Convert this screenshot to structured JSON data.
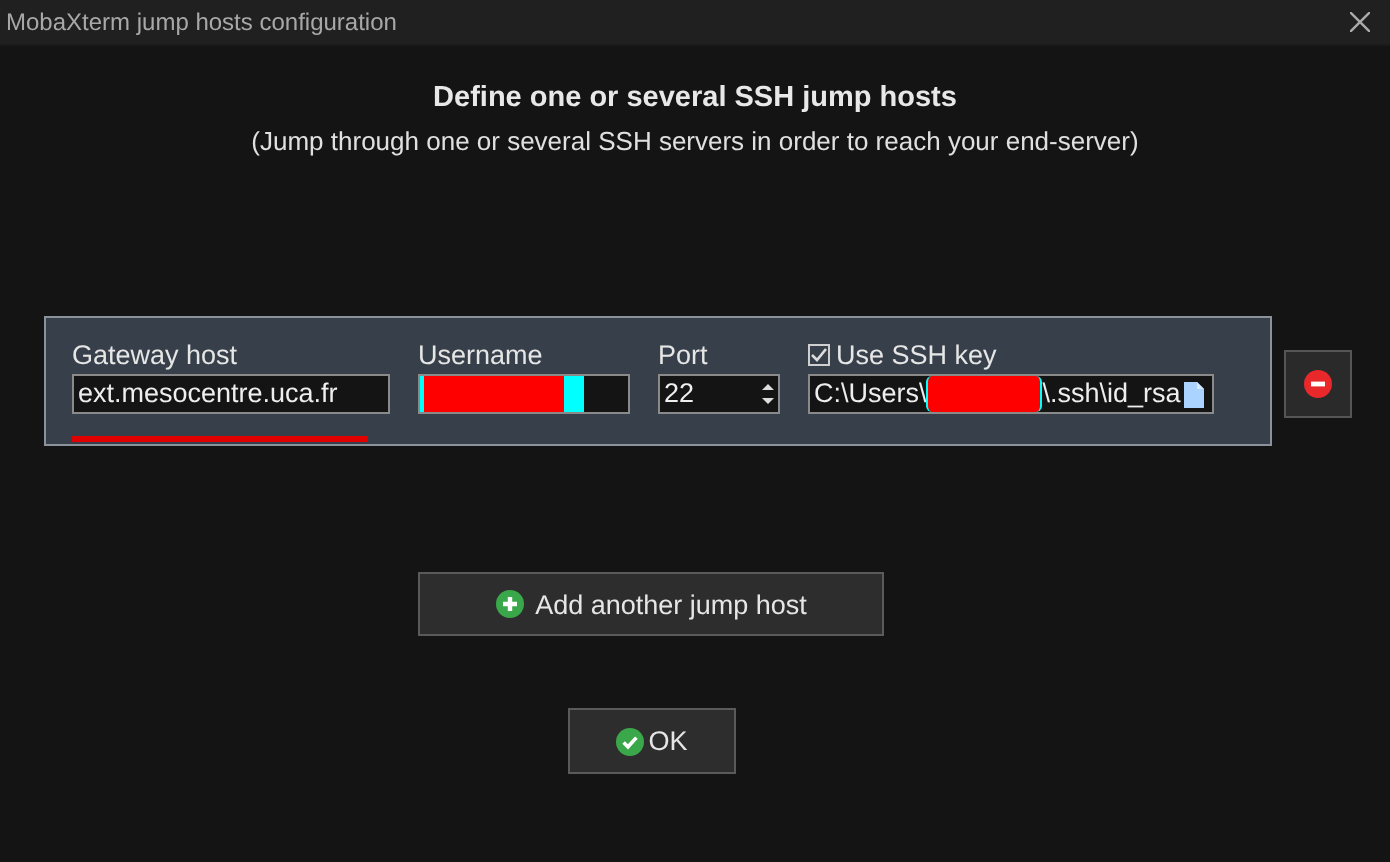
{
  "window": {
    "title": "MobaXterm jump hosts configuration"
  },
  "heading": "Define one or several SSH jump hosts",
  "subheading": "(Jump through one or several SSH servers in order to reach your end-server)",
  "hosts": [
    {
      "gateway_host": {
        "label": "Gateway host",
        "value": "ext.mesocentre.uca.fr",
        "underlined": true
      },
      "username": {
        "label": "Username",
        "redacted": true
      },
      "port": {
        "label": "Port",
        "value": "22"
      },
      "ssh_key": {
        "label": "Use SSH key",
        "checked": true,
        "value_start": "C:\\Users\\",
        "value_end": "\\.ssh\\id_rsa",
        "redacted": true
      }
    }
  ],
  "buttons": {
    "add": "Add another jump host",
    "ok": "OK"
  }
}
